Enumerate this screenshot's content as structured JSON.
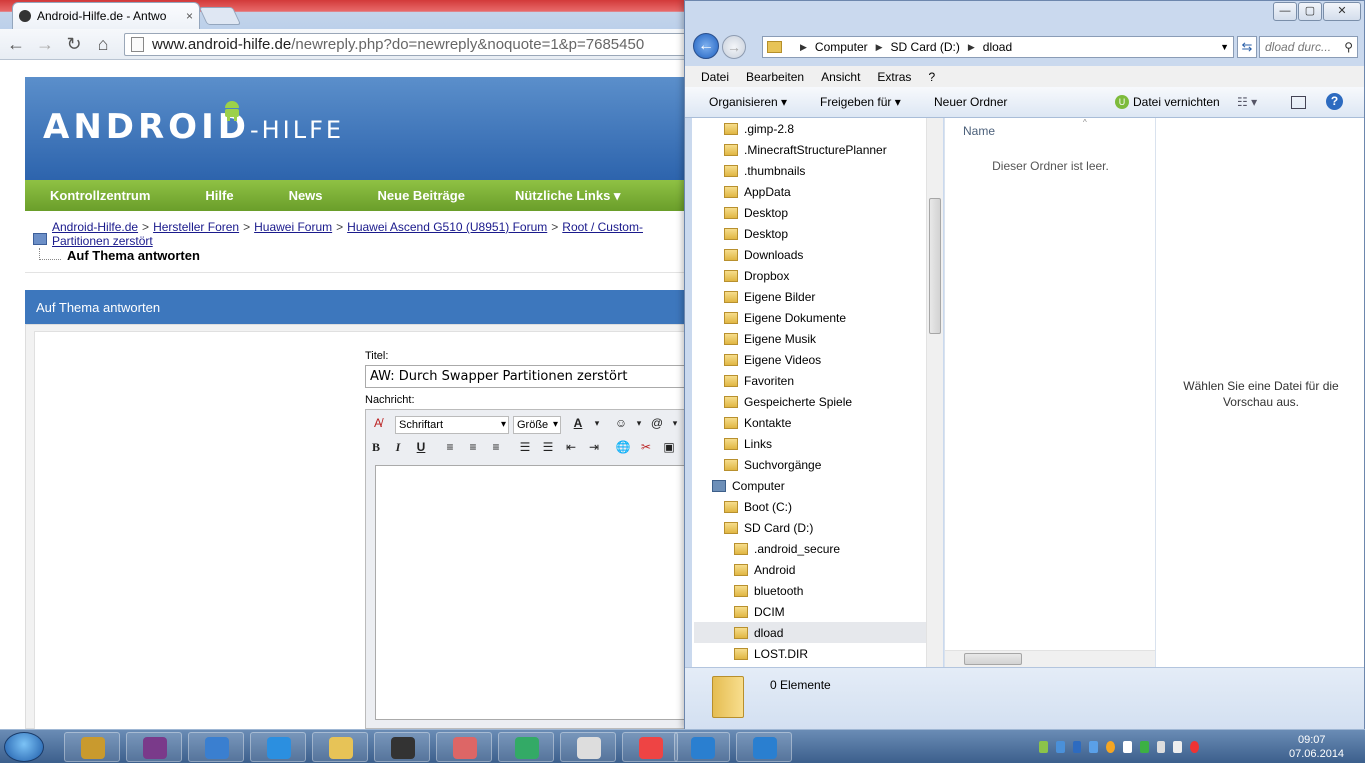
{
  "browser": {
    "tab_title": "Android-Hilfe.de - Antwo",
    "tab_close": "×",
    "url_host": "www.android-hilfe.de",
    "url_path": "/newreply.php?do=newreply&noquote=1&p=7685450"
  },
  "forum": {
    "logo_main": "ANDROID",
    "logo_suffix": "-HILFE",
    "nav": [
      "Kontrollzentrum",
      "Hilfe",
      "News",
      "Neue Beiträge",
      "Nützliche Links ▾"
    ],
    "breadcrumb": [
      "Android-Hilfe.de",
      "Hersteller Foren",
      "Huawei Forum",
      "Huawei Ascend G510 (U8951) Forum",
      "Root / Custom-"
    ],
    "breadcrumb_line2": "Partitionen zerstört",
    "current": "Auf Thema antworten",
    "reply_header": "Auf Thema antworten",
    "title_label": "Titel:",
    "title_value": "AW: Durch Swapper Partitionen zerstört",
    "message_label": "Nachricht:",
    "editor": {
      "font_select": "Schriftart",
      "size_select": "Größe"
    }
  },
  "explorer": {
    "window_controls": [
      "—",
      "▢",
      "✕"
    ],
    "address": [
      "Computer",
      "SD Card (D:)",
      "dload"
    ],
    "search_placeholder": "dload durc...",
    "menu": [
      "Datei",
      "Bearbeiten",
      "Ansicht",
      "Extras",
      "?"
    ],
    "commands": {
      "organize": "Organisieren ▾",
      "share": "Freigeben für ▾",
      "new_folder": "Neuer Ordner",
      "shred": "Datei vernichten"
    },
    "tree": [
      {
        "label": ".gimp-2.8",
        "indent": 1
      },
      {
        "label": ".MinecraftStructurePlanner",
        "indent": 1
      },
      {
        "label": ".thumbnails",
        "indent": 1
      },
      {
        "label": "AppData",
        "indent": 1
      },
      {
        "label": "Desktop",
        "indent": 1
      },
      {
        "label": "Desktop",
        "indent": 1
      },
      {
        "label": "Downloads",
        "indent": 1
      },
      {
        "label": "Dropbox",
        "indent": 1
      },
      {
        "label": "Eigene Bilder",
        "indent": 1
      },
      {
        "label": "Eigene Dokumente",
        "indent": 1
      },
      {
        "label": "Eigene Musik",
        "indent": 1
      },
      {
        "label": "Eigene Videos",
        "indent": 1
      },
      {
        "label": "Favoriten",
        "indent": 1
      },
      {
        "label": "Gespeicherte Spiele",
        "indent": 1
      },
      {
        "label": "Kontakte",
        "indent": 1
      },
      {
        "label": "Links",
        "indent": 1
      },
      {
        "label": "Suchvorgänge",
        "indent": 1
      },
      {
        "label": "Computer",
        "indent": 0
      },
      {
        "label": "Boot (C:)",
        "indent": 1
      },
      {
        "label": "SD Card (D:)",
        "indent": 1
      },
      {
        "label": ".android_secure",
        "indent": 2
      },
      {
        "label": "Android",
        "indent": 2
      },
      {
        "label": "bluetooth",
        "indent": 2
      },
      {
        "label": "DCIM",
        "indent": 2
      },
      {
        "label": "dload",
        "indent": 2,
        "selected": true
      },
      {
        "label": "LOST.DIR",
        "indent": 2
      }
    ],
    "column_name": "Name",
    "empty_message": "Dieser Ordner ist leer.",
    "preview_message": "Wählen Sie eine Datei für die Vorschau aus.",
    "status": "0 Elemente"
  },
  "taskbar": {
    "time": "09:07",
    "date": "07.06.2014",
    "apps": [
      "winrar",
      "archive",
      "itunes",
      "internet-explorer",
      "explorer",
      "steam",
      "snipping-tool",
      "monitor",
      "chrome",
      "picasa",
      "shield-c",
      "shield-v"
    ]
  }
}
